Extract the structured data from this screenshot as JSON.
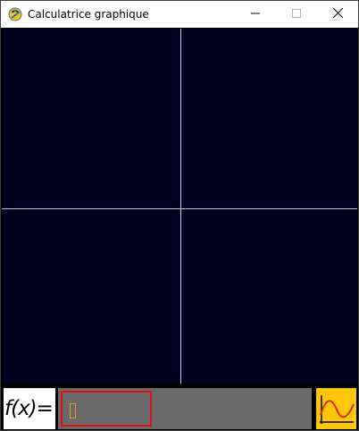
{
  "window": {
    "title": "Calculatrice graphique",
    "controls": {
      "minimize_icon": "minimize-icon",
      "maximize_icon": "maximize-icon",
      "close_icon": "close-icon"
    }
  },
  "plot": {
    "background_color": "#000020",
    "axis_color": "#c8c8d0"
  },
  "input": {
    "label": "f(x)=",
    "value": "",
    "placeholder": "",
    "border_color": "#e01010",
    "background_color": "#6a6a6a"
  },
  "plot_button": {
    "icon": "curve-plot-icon",
    "background_color": "#ffc60a",
    "curve_color": "#d03010"
  }
}
